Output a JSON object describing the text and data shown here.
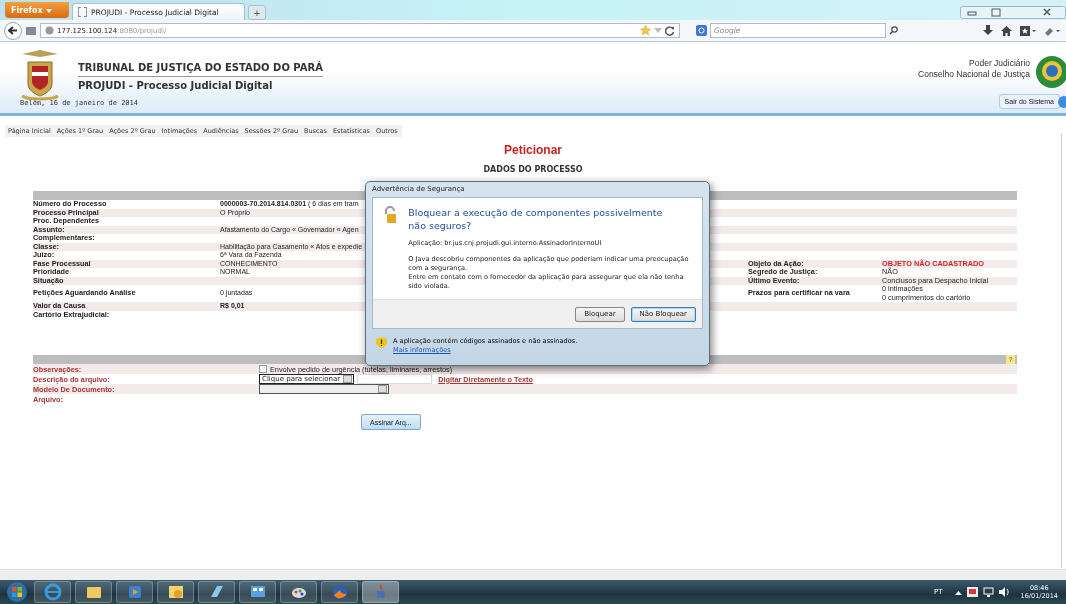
{
  "browser": {
    "menu_button": "Firefox",
    "tabs": [
      {
        "title": "PROJUDI - Processo Judicial Digital",
        "selected": true
      }
    ],
    "new_tab": "+",
    "url_host": "177.125.100.124",
    "url_rest": ":8080/projudi/",
    "search_placeholder": "Google"
  },
  "header": {
    "title": "TRIBUNAL DE JUSTIÇA DO ESTADO DO PARÁ",
    "subtitle": "PROJUDI - Processo Judicial Digital",
    "date": "Belém, 16 de janeiro de 2014",
    "org_line1": "Poder Judiciário",
    "org_line2": "Conselho Nacional de Justiça",
    "logout": "Sair do Sistema"
  },
  "nav": [
    "Página Inicial",
    "Ações 1º Grau",
    "Ações 2º Grau",
    "Intimações",
    "Audiências",
    "Sessões 2º Grau",
    "Buscas",
    "Estatísticas",
    "Outros"
  ],
  "page_title": "Peticionar",
  "section_title": "DADOS DO PROCESSO",
  "details": [
    {
      "label": "Número do Processo",
      "value": "**0000003-70.2014.814.0301** ( 6 dias em tram"
    },
    {
      "label": "Processo Principal",
      "value": "O Próprio"
    },
    {
      "label": "Proc. Dependentes"
    },
    {
      "label": "Assunto:",
      "value": "Afastamento do Cargo « Governador « Agen"
    },
    {
      "label": "Complementares:"
    },
    {
      "label": "Classe:",
      "value": "Habilitação para Casamento « Atos e expedie"
    },
    {
      "label": "Juízo:",
      "value": "6ª Vara da Fazenda"
    },
    {
      "label": "Fase Processual",
      "value": "CONHECIMENTO",
      "right_label": "Objeto da Ação:",
      "right_values": [
        "OBJETO NÃO CADASTRADO"
      ],
      "color": "#d42020"
    },
    {
      "label": "Prioridade",
      "value": "NORMAL",
      "right_label": "Segredo de Justiça:",
      "right_values": [
        "NÃO"
      ]
    },
    {
      "label": "Situação",
      "right_label": "Último Evento:",
      "right_values": [
        "Conclusos para Despacho Inicial"
      ]
    },
    {
      "label": "Petições Aguardando Análise",
      "value": "0 juntadas",
      "right_label": "Prazos para certificar na vara",
      "right_values": [
        "0 intimações",
        "0 cumprimentos do cartório"
      ]
    },
    {
      "label": "Valor da Causa",
      "value": "**R$ 0,01**"
    },
    {
      "label": "Cartório Extrajudicial:"
    }
  ],
  "form": {
    "help": "?",
    "rows": [
      {
        "kind": "checkbox",
        "label": "Observações:",
        "checked": false,
        "text": "Envolve pedido de urgência (tutelas, liminares, arrestos)"
      },
      {
        "kind": "select",
        "label": "Descrição do arquivo:",
        "value": "Clique para selecionar",
        "link": "Digitar Diretamente o Texto"
      },
      {
        "kind": "empty_select",
        "label": "Modelo De Documento:"
      },
      {
        "kind": "plain",
        "label": "Arquivo:"
      }
    ],
    "button": "Assinar Arq..."
  },
  "dialog": {
    "title": "Advertência de Segurança",
    "heading": "Bloquear a execução de componentes possivelmente não seguros?",
    "application": "Aplicação: br.jus.cnj.projudi.gui.interno.AssinadorInternoUI",
    "paragraphs": [
      "O Java descobriu componentes da aplicação que poderiam indicar uma preocupação com a segurança.",
      "Entre em contato com o fornecedor da aplicação para assegurar que ela não tenha sido violada."
    ],
    "buttons": [
      {
        "label": "Bloquear",
        "default": false
      },
      {
        "label": "Não Bloquear",
        "default": true
      }
    ],
    "footer_text": "A aplicação contém códigos assinados e não assinados.",
    "footer_link": "Mais informações"
  },
  "taskbar": {
    "language": "PT",
    "time": "08:46",
    "date": "16/01/2014"
  }
}
